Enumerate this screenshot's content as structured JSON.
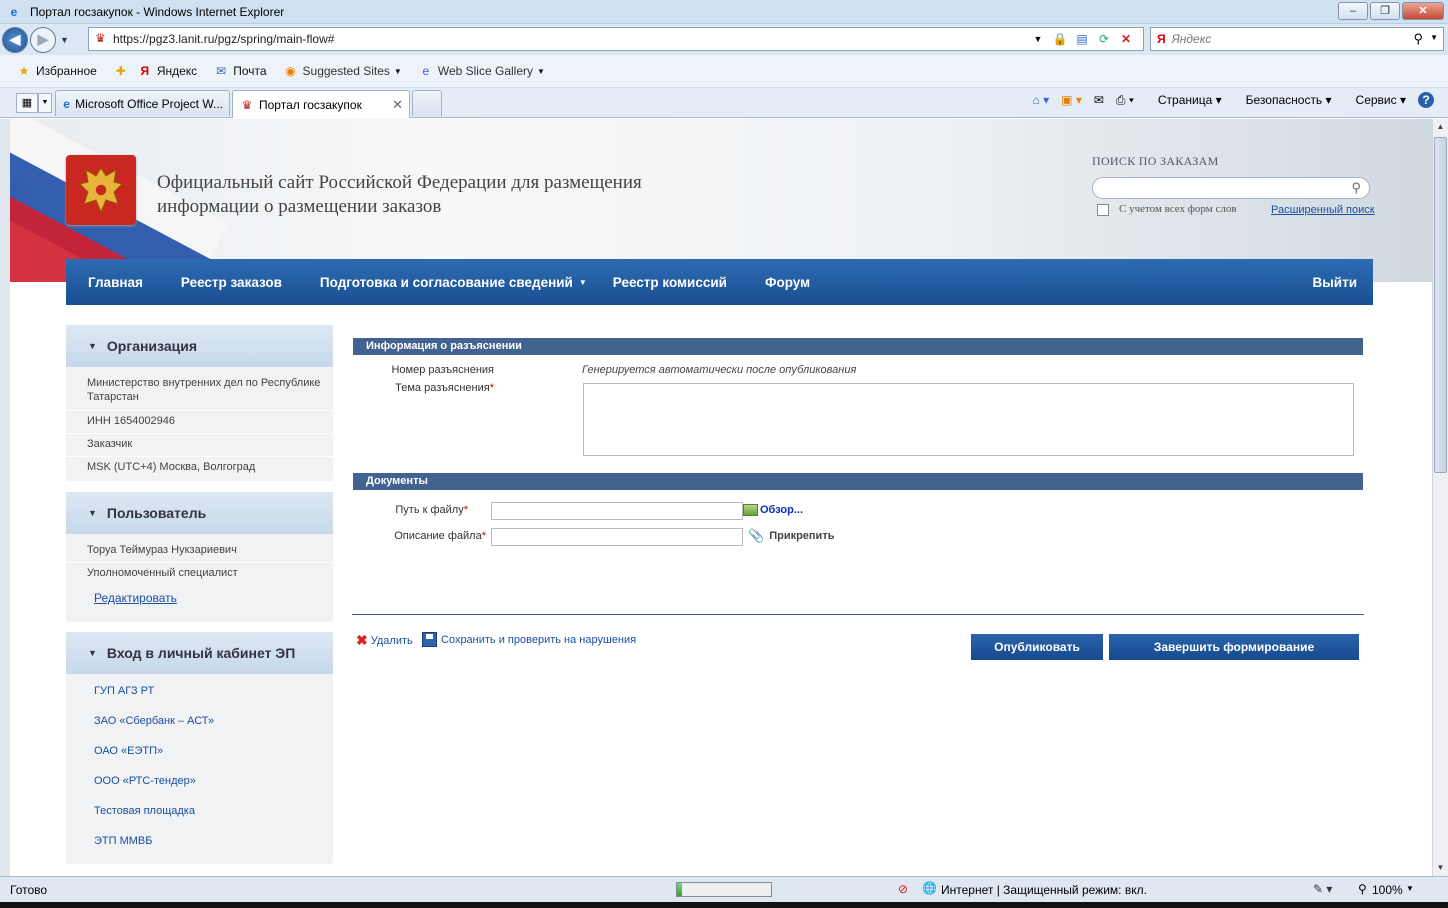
{
  "browser": {
    "window_title": "Портал госзакупок - Windows Internet Explorer",
    "url": "https://pgz3.lanit.ru/pgz/spring/main-flow#",
    "search_engine": "Яндекс",
    "search_placeholder": "Яндекс",
    "favorites": [
      {
        "label": "Избранное",
        "icon": "star-icon"
      },
      {
        "label": "Яндекс",
        "icon": "yandex-icon"
      },
      {
        "label": "Почта",
        "icon": "mail-icon"
      },
      {
        "label": "Suggested Sites",
        "icon": "suggested-sites-icon"
      },
      {
        "label": "Web Slice Gallery",
        "icon": "web-slice-icon"
      }
    ],
    "tabs": [
      {
        "label": "Microsoft Office Project W...",
        "active": false
      },
      {
        "label": "Портал госзакупок",
        "active": true
      }
    ],
    "commands": [
      "Страница",
      "Безопасность",
      "Сервис"
    ],
    "status_text": "Готово",
    "zone_text": "Интернет | Защищенный режим: вкл.",
    "zoom": "100%",
    "progress_fraction": 0.05
  },
  "site": {
    "title_line1": "Официальный сайт Российской Федерации для размещения",
    "title_line2": "информации о размещении заказов",
    "search_label": "ПОИСК ПО ЗАКАЗАМ",
    "search_checkbox_label": "С учетом всех форм слов",
    "advanced_search": "Расширенный поиск"
  },
  "nav": {
    "items": [
      "Главная",
      "Реестр заказов",
      "Подготовка и согласование сведений",
      "Реестр комиссий",
      "Форум"
    ],
    "logout": "Выйти"
  },
  "sidebar": {
    "org": {
      "title": "Организация",
      "name": "Министерство внутренних дел по Республике Татарстан",
      "inn": "ИНН 1654002946",
      "role": "Заказчик",
      "timezone": "MSK (UTC+4) Москва, Волгоград"
    },
    "user": {
      "title": "Пользователь",
      "name": "Торуа Теймураз Нукзариевич",
      "role": "Уполномоченный специалист",
      "edit": "Редактировать"
    },
    "ep": {
      "title": "Вход в личный кабинет ЭП",
      "links": [
        "ГУП АГЗ РТ",
        "ЗАО «Сбербанк – АСТ»",
        "ОАО «ЕЭТП»",
        "ООО «РТС-тендер»",
        "Тестовая площадка",
        "ЭТП ММВБ"
      ]
    }
  },
  "form": {
    "section1": "Информация о разъяснении",
    "number_label": "Номер разъяснения",
    "number_value": "Генерируется автоматически после опубликования",
    "topic_label": "Тема разъяснения",
    "section2": "Документы",
    "file_path_label": "Путь к файлу",
    "browse": "Обзор...",
    "file_desc_label": "Описание файла",
    "attach": "Прикрепить",
    "required_mark": "*",
    "delete": "Удалить",
    "save_check": "Сохранить и проверить на нарушения",
    "publish": "Опубликовать",
    "finish": "Завершить формирование"
  },
  "colors": {
    "nav_blue": "#1a4f91",
    "section_bar": "#42628f",
    "link": "#1b4fa0",
    "required": "#cc0000"
  }
}
